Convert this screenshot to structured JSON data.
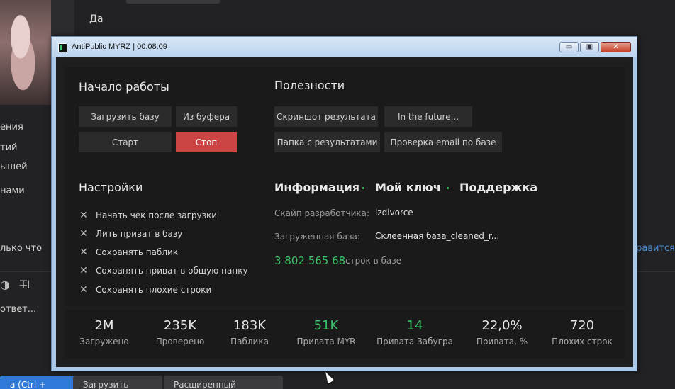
{
  "background": {
    "reply_word": "Да",
    "side_texts": [
      "ения",
      "тий",
      "ышей",
      "нами"
    ],
    "left_snippet": "лько что",
    "right_link": "равится",
    "reply_placeholder": "ответ...",
    "buttons": {
      "send": "а (Ctrl + Enter)",
      "upload_file": "Загрузить файл",
      "extended_mode": "Расширенный режим..."
    }
  },
  "window": {
    "title": "AntiPublic MYRZ | 00:08:09",
    "minimize": "▭",
    "maximize": "▣",
    "close": "✕"
  },
  "start": {
    "heading": "Начало работы",
    "load_base": "Загрузить базу",
    "from_clipboard": "Из буфера",
    "start": "Старт",
    "stop": "Стоп"
  },
  "utils": {
    "heading": "Полезности",
    "screenshot": "Скриншот результата",
    "future": "In the future...",
    "results_folder": "Папка с результатами",
    "email_check": "Проверка email по базе"
  },
  "settings": {
    "heading": "Настройки",
    "options": [
      "Начать чек после загрузки",
      "Лить приват в базу",
      "Сохранять паблик",
      "Сохранять приват в общую папку",
      "Сохранять плохие строки"
    ]
  },
  "info": {
    "tab_info": "Информация",
    "tab_key": "Мой ключ",
    "tab_support": "Поддержка",
    "dev_skype_label": "Скайп разработчика:",
    "dev_skype_value": "lzdivorce",
    "loaded_base_label": "Загруженная база:",
    "loaded_base_value": "Склеенная база_cleaned_r...",
    "line_count": "3 802 565 68",
    "line_count_suffix": "строк в базе"
  },
  "stats": [
    {
      "value": "2M",
      "label": "Загружено",
      "color": "#e6e6e6"
    },
    {
      "value": "235K",
      "label": "Проверено",
      "color": "#e6e6e6"
    },
    {
      "value": "183K",
      "label": "Паблика",
      "color": "#e6e6e6"
    },
    {
      "value": "51K",
      "label": "Привата MYR",
      "color": "#3bc16a"
    },
    {
      "value": "14",
      "label": "Привата Забугра",
      "color": "#3bc16a"
    },
    {
      "value": "22,0%",
      "label": "Привата, %",
      "color": "#e6e6e6"
    },
    {
      "value": "720",
      "label": "Плохих строк",
      "color": "#e6e6e6"
    }
  ],
  "colors": {
    "accent_green": "#3bc16a",
    "stop_red": "#cc4444"
  }
}
